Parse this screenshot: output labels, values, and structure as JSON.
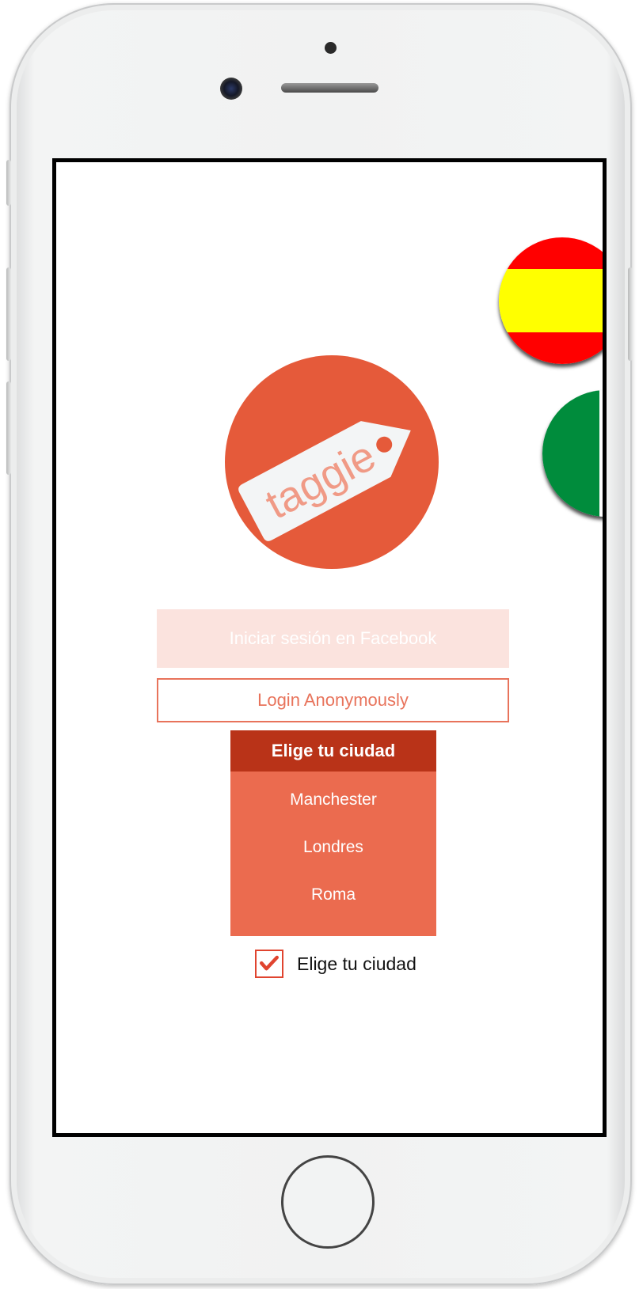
{
  "logo": {
    "text": "taggie",
    "brand_color": "#e55a3a"
  },
  "language_flags": [
    {
      "name": "spain-flag"
    },
    {
      "name": "italy-flag"
    }
  ],
  "login": {
    "facebook_label": "Iniciar sesión en Facebook",
    "anonymous_label": "Login Anonymously"
  },
  "city_picker": {
    "title": "Elige tu ciudad",
    "options": [
      "Manchester",
      "Londres",
      "Roma"
    ]
  },
  "remember_city": {
    "label": "Elige tu ciudad",
    "checked": true
  },
  "colors": {
    "accent": "#e8735b",
    "header_dark": "#b93318",
    "list_bg": "#eb6b4f"
  }
}
